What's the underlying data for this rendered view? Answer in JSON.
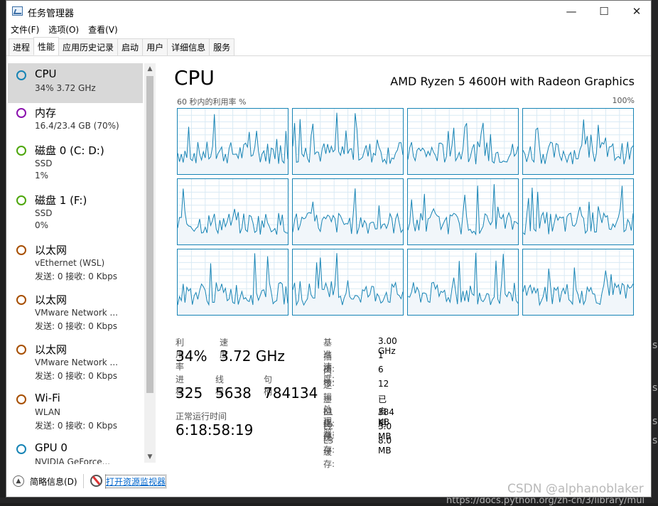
{
  "window": {
    "title": "任务管理器",
    "minimize": "—",
    "maximize": "☐",
    "close": "✕"
  },
  "menu": [
    "文件(F)",
    "选项(O)",
    "查看(V)"
  ],
  "tabs": [
    "进程",
    "性能",
    "应用历史记录",
    "启动",
    "用户",
    "详细信息",
    "服务"
  ],
  "sidebar": [
    {
      "name": "CPU",
      "l1": "34% 3.72 GHz",
      "l2": "",
      "color": "#1784b5"
    },
    {
      "name": "内存",
      "l1": "16.4/23.4 GB (70%)",
      "l2": "",
      "color": "#8b12ae"
    },
    {
      "name": "磁盘 0 (C: D:)",
      "l1": "SSD",
      "l2": "1%",
      "color": "#4da60c"
    },
    {
      "name": "磁盘 1 (F:)",
      "l1": "SSD",
      "l2": "0%",
      "color": "#4da60c"
    },
    {
      "name": "以太网",
      "l1": "vEthernet (WSL)",
      "l2": "发送: 0 接收: 0 Kbps",
      "color": "#a74f01"
    },
    {
      "name": "以太网",
      "l1": "VMware Network ...",
      "l2": "发送: 0 接收: 0 Kbps",
      "color": "#a74f01"
    },
    {
      "name": "以太网",
      "l1": "VMware Network ...",
      "l2": "发送: 0 接收: 0 Kbps",
      "color": "#a74f01"
    },
    {
      "name": "Wi-Fi",
      "l1": "WLAN",
      "l2": "发送: 0 接收: 0 Kbps",
      "color": "#a74f01"
    },
    {
      "name": "GPU 0",
      "l1": "NVIDIA GeForce...",
      "l2": "",
      "color": "#1784b5"
    }
  ],
  "main": {
    "title": "CPU",
    "model": "AMD Ryzen 5 4600H with Radeon Graphics",
    "graph_label": "60 秒内的利用率 %",
    "graph_max": "100%",
    "stats": {
      "util_label": "利用率",
      "util": "34%",
      "speed_label": "速度",
      "speed": "3.72 GHz",
      "proc_label": "进程",
      "proc": "325",
      "thread_label": "线程",
      "thread": "5638",
      "handle_label": "句柄",
      "handle": "784134",
      "uptime_label": "正常运行时间",
      "uptime": "6:18:58:19"
    },
    "details": [
      {
        "k": "基准速度:",
        "v": "3.00 GHz"
      },
      {
        "k": "插槽:",
        "v": "1"
      },
      {
        "k": "内核:",
        "v": "6"
      },
      {
        "k": "逻辑处理器:",
        "v": "12"
      },
      {
        "k": "虚拟化:",
        "v": "已启用"
      },
      {
        "k": "L1 缓存:",
        "v": "384 KB"
      },
      {
        "k": "L2 缓存:",
        "v": "3.0 MB"
      },
      {
        "k": "L3 缓存:",
        "v": "8.0 MB"
      }
    ]
  },
  "footer": {
    "less": "简略信息(D)",
    "monitor": "打开资源监视器"
  },
  "watermark": "CSDN @alphanoblaker",
  "background_text": [
    "s",
    "s",
    "s",
    "s",
    "https://docs.python.org/zh-cn/3/library/mul"
  ]
}
